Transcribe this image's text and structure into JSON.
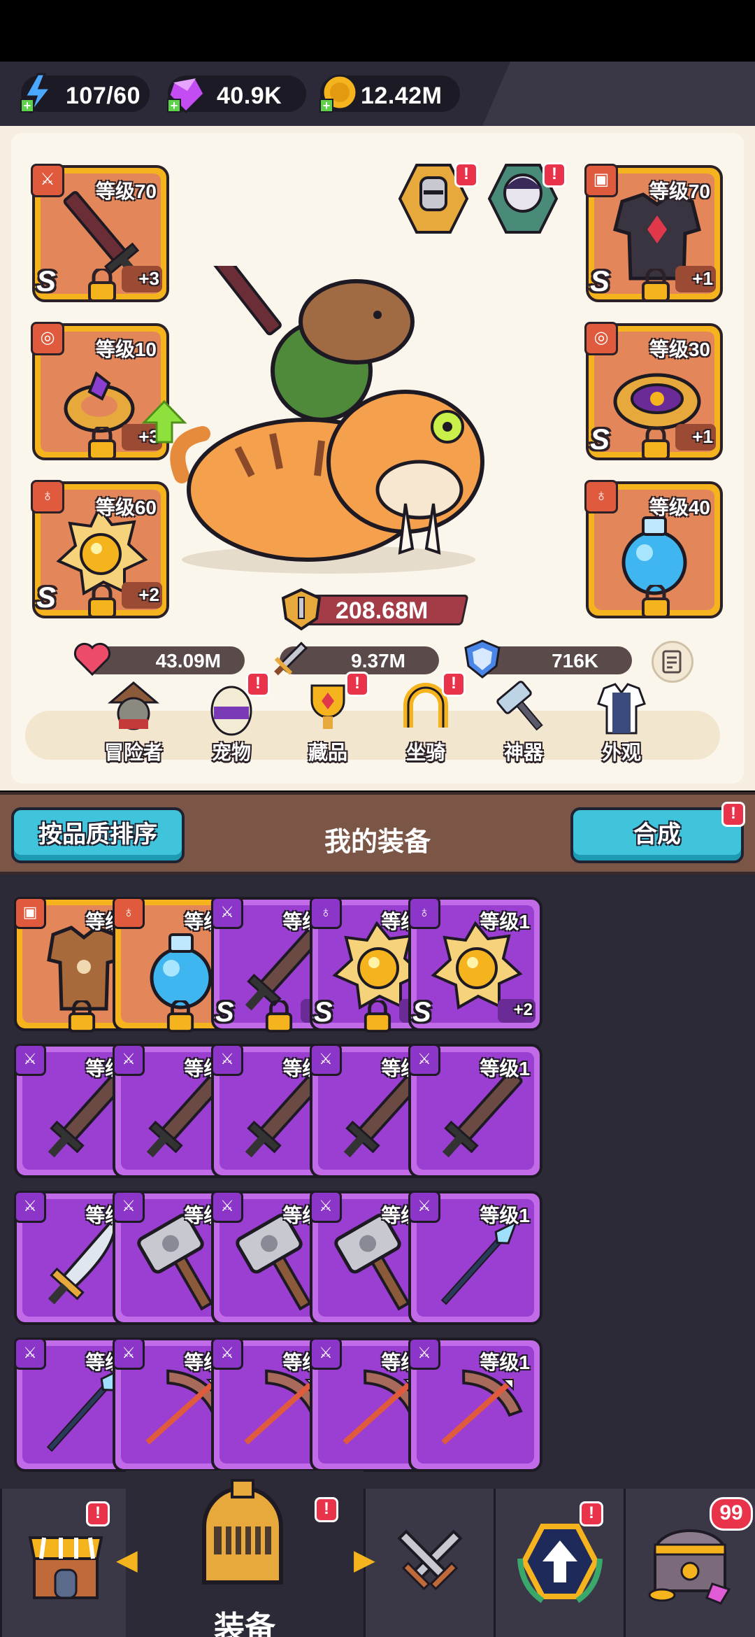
{
  "resources": [
    {
      "name": "energy",
      "icon": "lightning-icon",
      "value": "107/60"
    },
    {
      "name": "gems",
      "icon": "gem-icon",
      "value": "40.9K"
    },
    {
      "name": "coins",
      "icon": "coin-icon",
      "value": "12.42M"
    }
  ],
  "hero": {
    "left_slots": [
      {
        "level": "等级70",
        "plus": "+3",
        "grade": "S"
      },
      {
        "level": "等级10",
        "plus": "+3",
        "grade": ""
      },
      {
        "level": "等级60",
        "plus": "+2",
        "grade": "S"
      }
    ],
    "right_slots": [
      {
        "level": "等级70",
        "plus": "+1",
        "grade": "S"
      },
      {
        "level": "等级30",
        "plus": "+1",
        "grade": "S"
      },
      {
        "level": "等级40",
        "plus": "",
        "grade": ""
      }
    ],
    "power": "208.68M",
    "stats": {
      "hp": "43.09M",
      "attack": "9.37M",
      "defense": "716K"
    }
  },
  "menu": [
    {
      "label": "冒险者",
      "badge": ""
    },
    {
      "label": "宠物",
      "badge": "!"
    },
    {
      "label": "藏品",
      "badge": "!"
    },
    {
      "label": "坐骑",
      "badge": "!"
    },
    {
      "label": "神器",
      "badge": ""
    },
    {
      "label": "外观",
      "badge": ""
    }
  ],
  "sortbar": {
    "sort_label": "按品质排序",
    "title": "我的装备",
    "merge_label": "合成",
    "merge_badge": "!"
  },
  "inventory": [
    {
      "level": "等级1",
      "rarity": "gold",
      "kind": "armor",
      "plus": "",
      "grade": "",
      "locked": true
    },
    {
      "level": "等级1",
      "rarity": "gold",
      "kind": "potion",
      "plus": "",
      "grade": "",
      "locked": true
    },
    {
      "level": "等级1",
      "rarity": "purple",
      "kind": "sword",
      "plus": "+2",
      "grade": "S",
      "locked": true
    },
    {
      "level": "等级1",
      "rarity": "purple",
      "kind": "medal",
      "plus": "+2",
      "grade": "S",
      "locked": true
    },
    {
      "level": "等级1",
      "rarity": "purple",
      "kind": "medal",
      "plus": "+2",
      "grade": "S",
      "locked": false
    },
    {
      "level": "等级1",
      "rarity": "purple",
      "kind": "sword",
      "plus": "",
      "grade": "",
      "locked": false
    },
    {
      "level": "等级1",
      "rarity": "purple",
      "kind": "sword",
      "plus": "",
      "grade": "",
      "locked": false
    },
    {
      "level": "等级1",
      "rarity": "purple",
      "kind": "sword",
      "plus": "",
      "grade": "",
      "locked": false
    },
    {
      "level": "等级1",
      "rarity": "purple",
      "kind": "sword",
      "plus": "",
      "grade": "",
      "locked": false
    },
    {
      "level": "等级1",
      "rarity": "purple",
      "kind": "sword",
      "plus": "",
      "grade": "",
      "locked": false
    },
    {
      "level": "等级1",
      "rarity": "purple",
      "kind": "blade",
      "plus": "",
      "grade": "",
      "locked": false
    },
    {
      "level": "等级1",
      "rarity": "purple",
      "kind": "hammer",
      "plus": "",
      "grade": "",
      "locked": false
    },
    {
      "level": "等级1",
      "rarity": "purple",
      "kind": "hammer",
      "plus": "",
      "grade": "",
      "locked": false
    },
    {
      "level": "等级1",
      "rarity": "purple",
      "kind": "hammer",
      "plus": "",
      "grade": "",
      "locked": false
    },
    {
      "level": "等级1",
      "rarity": "purple",
      "kind": "spear",
      "plus": "",
      "grade": "",
      "locked": false
    },
    {
      "level": "等级1",
      "rarity": "purple",
      "kind": "spear",
      "plus": "",
      "grade": "",
      "locked": false
    },
    {
      "level": "等级1",
      "rarity": "purple",
      "kind": "bow",
      "plus": "",
      "grade": "",
      "locked": false
    },
    {
      "level": "等级1",
      "rarity": "purple",
      "kind": "bow",
      "plus": "",
      "grade": "",
      "locked": false
    },
    {
      "level": "等级1",
      "rarity": "purple",
      "kind": "bow",
      "plus": "",
      "grade": "",
      "locked": false
    },
    {
      "level": "等级1",
      "rarity": "purple",
      "kind": "bow",
      "plus": "",
      "grade": "",
      "locked": false
    }
  ],
  "bottom_nav": {
    "active_label": "装备",
    "chest_count": "99",
    "badge": "!"
  },
  "colors": {
    "gold": "#f5b31d",
    "purple": "#c26be8",
    "cyan": "#3fc4dc",
    "red_badge": "#e8334a"
  }
}
